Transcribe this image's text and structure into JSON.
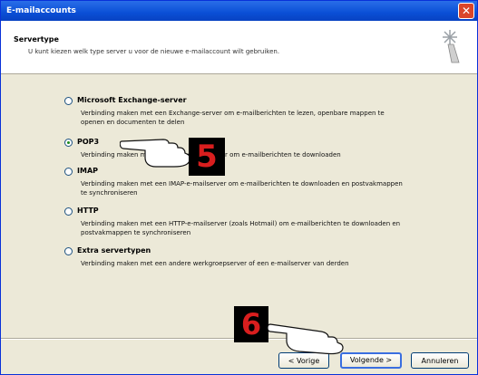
{
  "window": {
    "title": "E-mailaccounts",
    "close_glyph": "✕"
  },
  "header": {
    "title": "Servertype",
    "subtitle": "U kunt kiezen welk type server u voor de nieuwe e-mailaccount wilt gebruiken."
  },
  "options": [
    {
      "label": "Microsoft Exchange-server",
      "desc": "Verbinding maken met een Exchange-server om e-mailberichten te lezen, openbare mappen te openen en documenten te delen",
      "checked": false
    },
    {
      "label": "POP3",
      "desc": "Verbinding maken met een POP3-e-mailserver om e-mailberichten te downloaden",
      "checked": true
    },
    {
      "label": "IMAP",
      "desc": "Verbinding maken met een IMAP-e-mailserver om e-mailberichten te downloaden en postvakmappen te synchroniseren",
      "checked": false
    },
    {
      "label": "HTTP",
      "desc": "Verbinding maken met een HTTP-e-mailserver (zoals Hotmail) om e-mailberichten te downloaden en postvakmappen te synchroniseren",
      "checked": false
    },
    {
      "label": "Extra servertypen",
      "desc": "Verbinding maken met een andere werkgroepserver of een e-mailserver van derden",
      "checked": false
    }
  ],
  "buttons": {
    "back": "< Vorige",
    "next": "Volgende >",
    "cancel": "Annuleren"
  },
  "callouts": {
    "step5": "5",
    "step6": "6"
  },
  "colors": {
    "title_blue": "#0a4fd6",
    "callout_red": "#d91e1e"
  }
}
